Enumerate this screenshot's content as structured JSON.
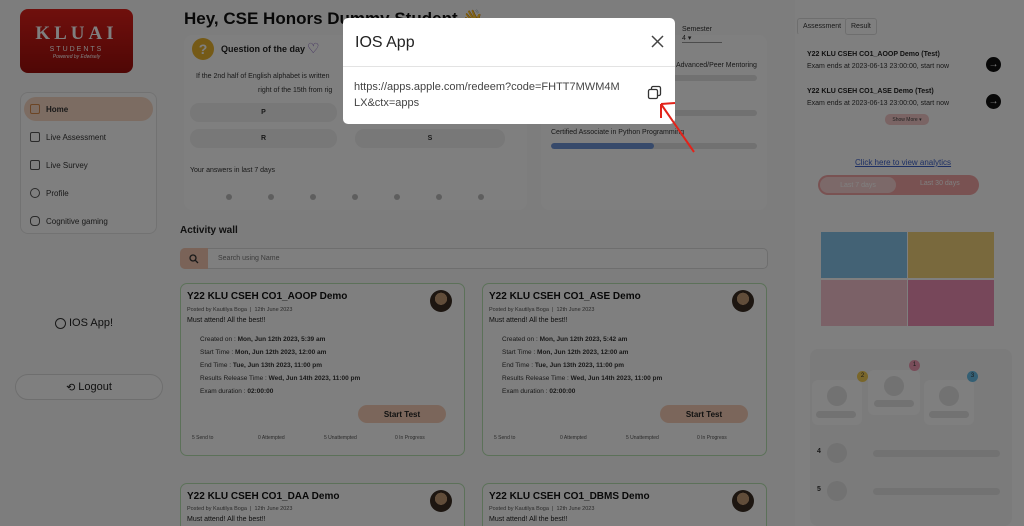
{
  "brand": {
    "name": "KLUAI",
    "sub": "STUDENTS",
    "tagline": "Powered by Edwisely"
  },
  "sidebar": {
    "items": [
      {
        "label": "Home",
        "icon": "home-icon",
        "active": true
      },
      {
        "label": "Live Assessment",
        "icon": "assessment-icon",
        "active": false
      },
      {
        "label": "Live Survey",
        "icon": "survey-icon",
        "active": false
      },
      {
        "label": "Profile",
        "icon": "profile-icon",
        "active": false
      },
      {
        "label": "Cognitive gaming",
        "icon": "gamepad-icon",
        "active": false
      }
    ],
    "ios_app": "IOS App!",
    "logout": "Logout"
  },
  "header": {
    "greeting": "Hey, CSE Honors Dummy Student 👋"
  },
  "question": {
    "title": "Question of the day",
    "text_line1": "If the 2nd half of English alphabet is written",
    "text_line2": "right of the 15th from rig",
    "options": [
      "P",
      "",
      "R",
      "S"
    ],
    "answers_label": "Your answers in last 7 days"
  },
  "progress": {
    "semester_label": "Semester",
    "semester_value": "4",
    "items": [
      {
        "label": "Advanced/Peer Mentoring",
        "value": 0
      },
      {
        "label": "",
        "value": 0
      },
      {
        "label": "Certified Associate in Python Programming",
        "value": 0.5
      }
    ]
  },
  "wall": {
    "title": "Activity wall",
    "search_placeholder": "Search using Name",
    "cards": [
      {
        "title": "Y22 KLU CSEH CO1_AOOP Demo",
        "posted_by": "Posted by Kautilya Boga",
        "date": "12th June 2023",
        "message": "Must attend! All the best!!",
        "created_label": "Created on :",
        "created": "Mon, Jun 12th 2023, 5:39 am",
        "start_label": "Start Time :",
        "start": "Mon, Jun 12th 2023, 12:00 am",
        "end_label": "End Time :",
        "end": "Tue, Jun 13th 2023, 11:00 pm",
        "release_label": "Results Release Time :",
        "release": "Wed, Jun 14th 2023, 11:00 pm",
        "duration_label": "Exam duration :",
        "duration": "02:00:00",
        "button": "Start Test",
        "stats": [
          "5 Send to",
          "0 Attempted",
          "5 Unattempted",
          "0 In Progress"
        ]
      },
      {
        "title": "Y22 KLU CSEH CO1_ASE Demo",
        "posted_by": "Posted by Kautilya Boga",
        "date": "12th June 2023",
        "message": "Must attend! All the best!!",
        "created_label": "Created on :",
        "created": "Mon, Jun 12th 2023, 5:42 am",
        "start_label": "Start Time :",
        "start": "Mon, Jun 12th 2023, 12:00 am",
        "end_label": "End Time :",
        "end": "Tue, Jun 13th 2023, 11:00 pm",
        "release_label": "Results Release Time :",
        "release": "Wed, Jun 14th 2023, 11:00 pm",
        "duration_label": "Exam duration :",
        "duration": "02:00:00",
        "button": "Start Test",
        "stats": [
          "5 Send to",
          "0 Attempted",
          "5 Unattempted",
          "0 In Progress"
        ]
      },
      {
        "title": "Y22 KLU CSEH CO1_DAA Demo",
        "posted_by": "Posted by Kautilya Boga",
        "date": "12th June 2023",
        "message": "Must attend! All the best!!"
      },
      {
        "title": "Y22 KLU CSEH CO1_DBMS Demo",
        "posted_by": "Posted by Kautilya Boga",
        "date": "12th June 2023",
        "message": "Must attend! All the best!!"
      }
    ]
  },
  "right_panel": {
    "tabs": [
      "Assessment",
      "Result"
    ],
    "exams": [
      {
        "title": "Y22 KLU CSEH CO1_AOOP Demo (Test)",
        "sub": "Exam ends at 2023-06-13 23:00:00, start now"
      },
      {
        "title": "Y22 KLU CSEH CO1_ASE Demo (Test)",
        "sub": "Exam ends at 2023-06-13 23:00:00, start now"
      }
    ],
    "show_more": "Show More",
    "analytics_link": "Click here to view analytics",
    "toggle": [
      "Last 7 days",
      "Last 30 days"
    ],
    "tile_colors": [
      "#86c5ea",
      "#f3d27a",
      "#f6c3cf",
      "#ef8fb4"
    ],
    "podium": [
      "2",
      "1",
      "3"
    ],
    "ranks": [
      "4",
      "5"
    ]
  },
  "modal": {
    "title": "IOS App",
    "link": "https://apps.apple.com/redeem?code=FHTT7MWM4MLX&ctx=apps"
  }
}
